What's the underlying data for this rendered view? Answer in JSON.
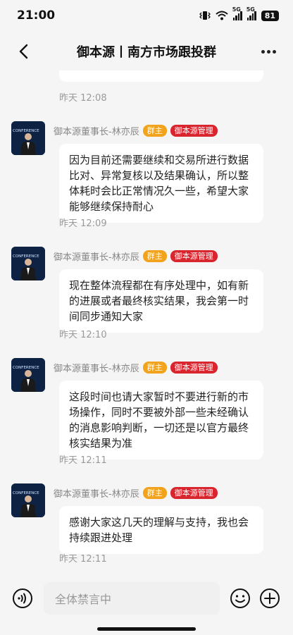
{
  "status": {
    "time": "21:00",
    "net1": "5G",
    "net2": "5G",
    "battery": "81"
  },
  "nav": {
    "title": "御本源丨南方市场跟投群"
  },
  "first_timestamp": "昨天 12:08",
  "messages": [
    {
      "sender": "御本源董事长-林亦辰",
      "tag_owner": "群主",
      "tag_admin": "御本源管理",
      "text": "因为目前还需要继续和交易所进行数据比对、异常复核以及结果确认，所以整体耗时会比正常情况久一些，希望大家能够继续保持耐心",
      "time": "昨天 12:09"
    },
    {
      "sender": "御本源董事长-林亦辰",
      "tag_owner": "群主",
      "tag_admin": "御本源管理",
      "text": "现在整体流程都在有序处理中，如有新的进展或者最终核实结果，我会第一时间同步通知大家",
      "time": "昨天 12:10"
    },
    {
      "sender": "御本源董事长-林亦辰",
      "tag_owner": "群主",
      "tag_admin": "御本源管理",
      "text": "这段时间也请大家暂时不要进行新的市场操作，同时不要被外部一些未经确认的消息影响判断，一切还是以官方最终核实结果为准",
      "time": "昨天 12:11"
    },
    {
      "sender": "御本源董事长-林亦辰",
      "tag_owner": "群主",
      "tag_admin": "御本源管理",
      "text": "感谢大家这几天的理解与支持，我也会持续跟进处理",
      "time": "昨天 12:11"
    }
  ],
  "input": {
    "placeholder": "全体禁言中"
  },
  "avatar_text": "CONFERENCE",
  "colors": {
    "owner_tag": "#f2a31b",
    "admin_tag": "#d9252e",
    "background": "#f5f5f5"
  }
}
